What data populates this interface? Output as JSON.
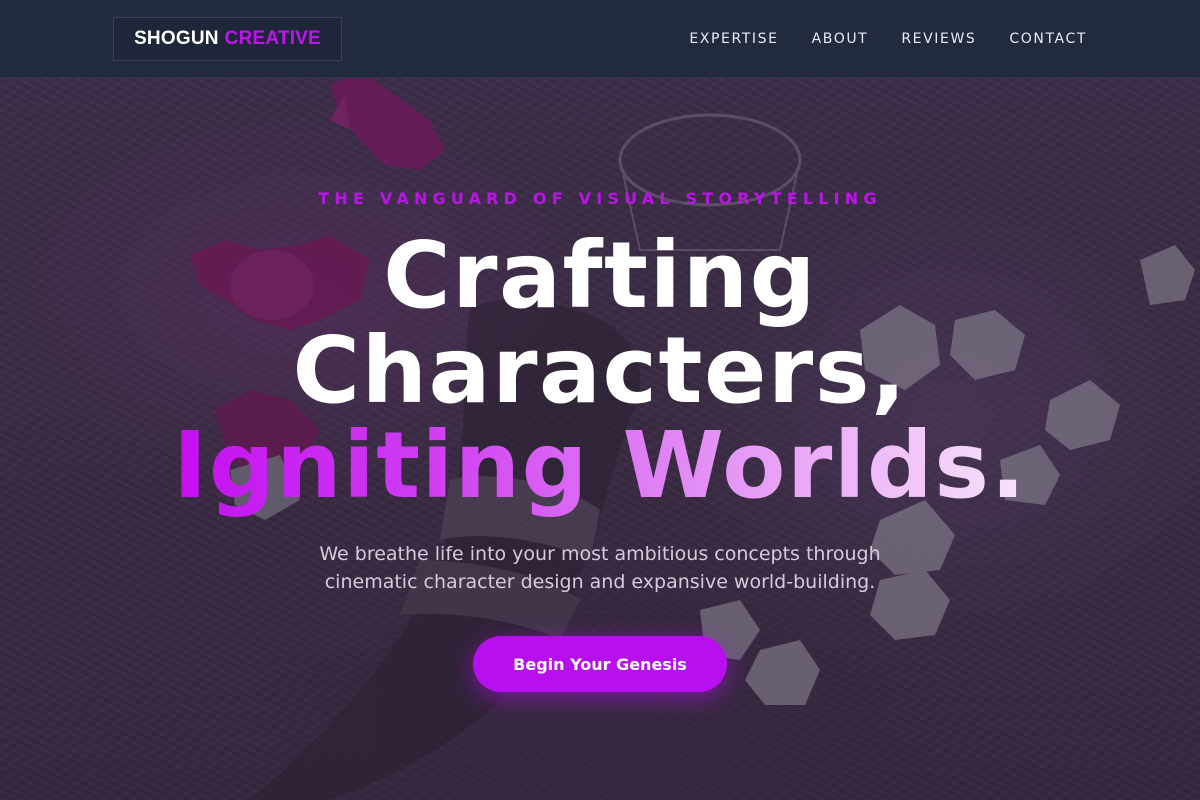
{
  "brand": {
    "name_main": "SHOGUN",
    "name_accent": "CREATIVE",
    "accent_color": "#c013f0"
  },
  "nav": {
    "items": [
      {
        "label": "EXPERTISE"
      },
      {
        "label": "ABOUT"
      },
      {
        "label": "REVIEWS"
      },
      {
        "label": "CONTACT"
      }
    ]
  },
  "hero": {
    "eyebrow": "THE VANGUARD OF VISUAL STORYTELLING",
    "headline_line1": "Crafting",
    "headline_line2": "Characters,",
    "headline_line3": "Igniting Worlds.",
    "subtext": "We breathe life into your most ambitious concepts through cinematic character design and expansive world-building.",
    "cta_label": "Begin Your Genesis",
    "background_image": "hand-with-chain-bracelets-candy-and-petals-on-purple-fur",
    "colors": {
      "navbar_bg": "#222a3e",
      "cta_bg": "#b80ff0",
      "eyebrow": "#b815e6",
      "gradient_start": "#c30ff0",
      "gradient_end": "#f8e4fb"
    }
  }
}
